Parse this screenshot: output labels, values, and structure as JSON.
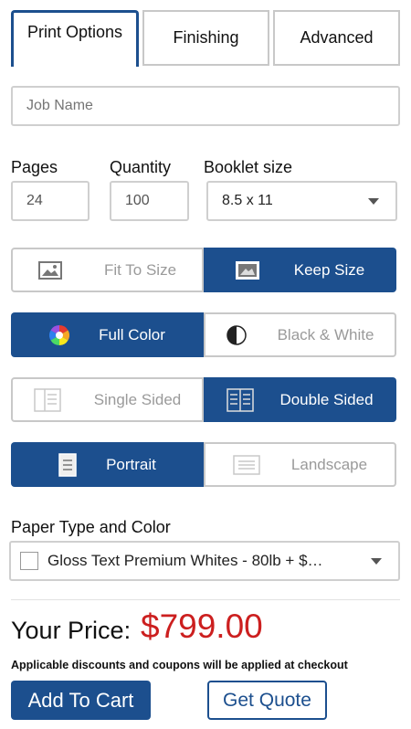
{
  "tabs": [
    {
      "label": "Print Options",
      "active": true
    },
    {
      "label": "Finishing",
      "active": false
    },
    {
      "label": "Advanced",
      "active": false
    }
  ],
  "job_name": {
    "placeholder": "Job Name",
    "value": ""
  },
  "pages": {
    "label": "Pages",
    "value": "24"
  },
  "quantity": {
    "label": "Quantity",
    "value": "100"
  },
  "booklet_size": {
    "label": "Booklet size",
    "value": "8.5 x 11"
  },
  "fit_group": {
    "options": [
      "Fit To Size",
      "Keep Size"
    ],
    "selected": "Keep Size"
  },
  "color_group": {
    "options": [
      "Full Color",
      "Black & White"
    ],
    "selected": "Full Color"
  },
  "sided_group": {
    "options": [
      "Single Sided",
      "Double Sided"
    ],
    "selected": "Double Sided"
  },
  "orientation_group": {
    "options": [
      "Portrait",
      "Landscape"
    ],
    "selected": "Portrait"
  },
  "paper": {
    "label": "Paper Type and Color",
    "value": "Gloss Text Premium Whites - 80lb + $…"
  },
  "price": {
    "label": "Your Price:",
    "value": "$799.00"
  },
  "note": "Applicable discounts and coupons will be applied at checkout",
  "buttons": {
    "add_to_cart": "Add To Cart",
    "get_quote": "Get Quote"
  },
  "colors": {
    "accent": "#1c4f8e",
    "price": "#cc1f1f"
  },
  "icons": [
    "image-icon",
    "image-icon",
    "color-wheel-icon",
    "half-circle-icon",
    "single-page-icon",
    "double-page-icon",
    "portrait-page-icon",
    "landscape-page-icon",
    "chevron-down-icon"
  ]
}
